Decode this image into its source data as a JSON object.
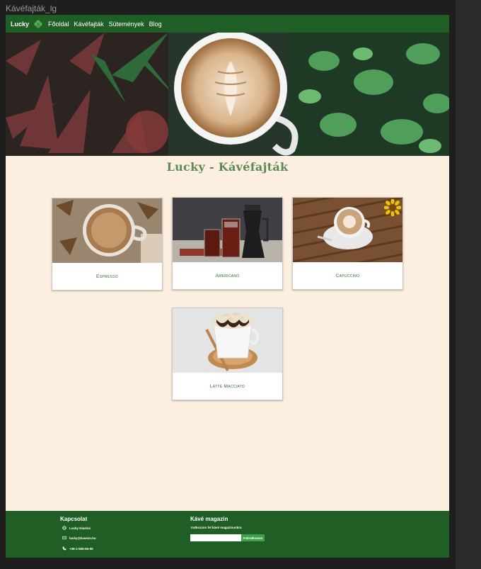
{
  "window": {
    "title": "Kávéfajták_lg"
  },
  "navbar": {
    "brand": "Lucky",
    "logo_icon": "clover-icon",
    "links": [
      "Főoldal",
      "Kávéfajták",
      "Sütemények",
      "Blog"
    ]
  },
  "hero": {
    "image": "latte-art-cup-among-succulents"
  },
  "page": {
    "title": "Lucky - Kávéfajták"
  },
  "cards": [
    {
      "label": "Espresso",
      "image": "espresso-cup-on-wood"
    },
    {
      "label": "Americano",
      "image": "iced-americano-moka-pot"
    },
    {
      "label": "Capuccino",
      "image": "cappuccino-on-wooden-deck"
    },
    {
      "label": "Latte Macciato",
      "image": "latte-macchiato-with-cream"
    }
  ],
  "footer": {
    "contact": {
      "heading": "Kapcsolat",
      "items": [
        {
          "icon": "globe-icon",
          "text": "Lucky Kávézó"
        },
        {
          "icon": "mail-icon",
          "text": "lucky@kavezo.hu"
        },
        {
          "icon": "phone-icon",
          "text": "+36-1-555-55-55"
        }
      ]
    },
    "magazine": {
      "heading": "Kávé magazin",
      "subtitle": "Iratkozzon fel kávé magazinunkra",
      "input_value": "",
      "button_label": "Feliratkozom"
    }
  },
  "colors": {
    "nav_green": "#1f5f25",
    "page_bg": "#fcefdf",
    "title_green": "#5a8a55",
    "button_green": "#3fa04a"
  }
}
